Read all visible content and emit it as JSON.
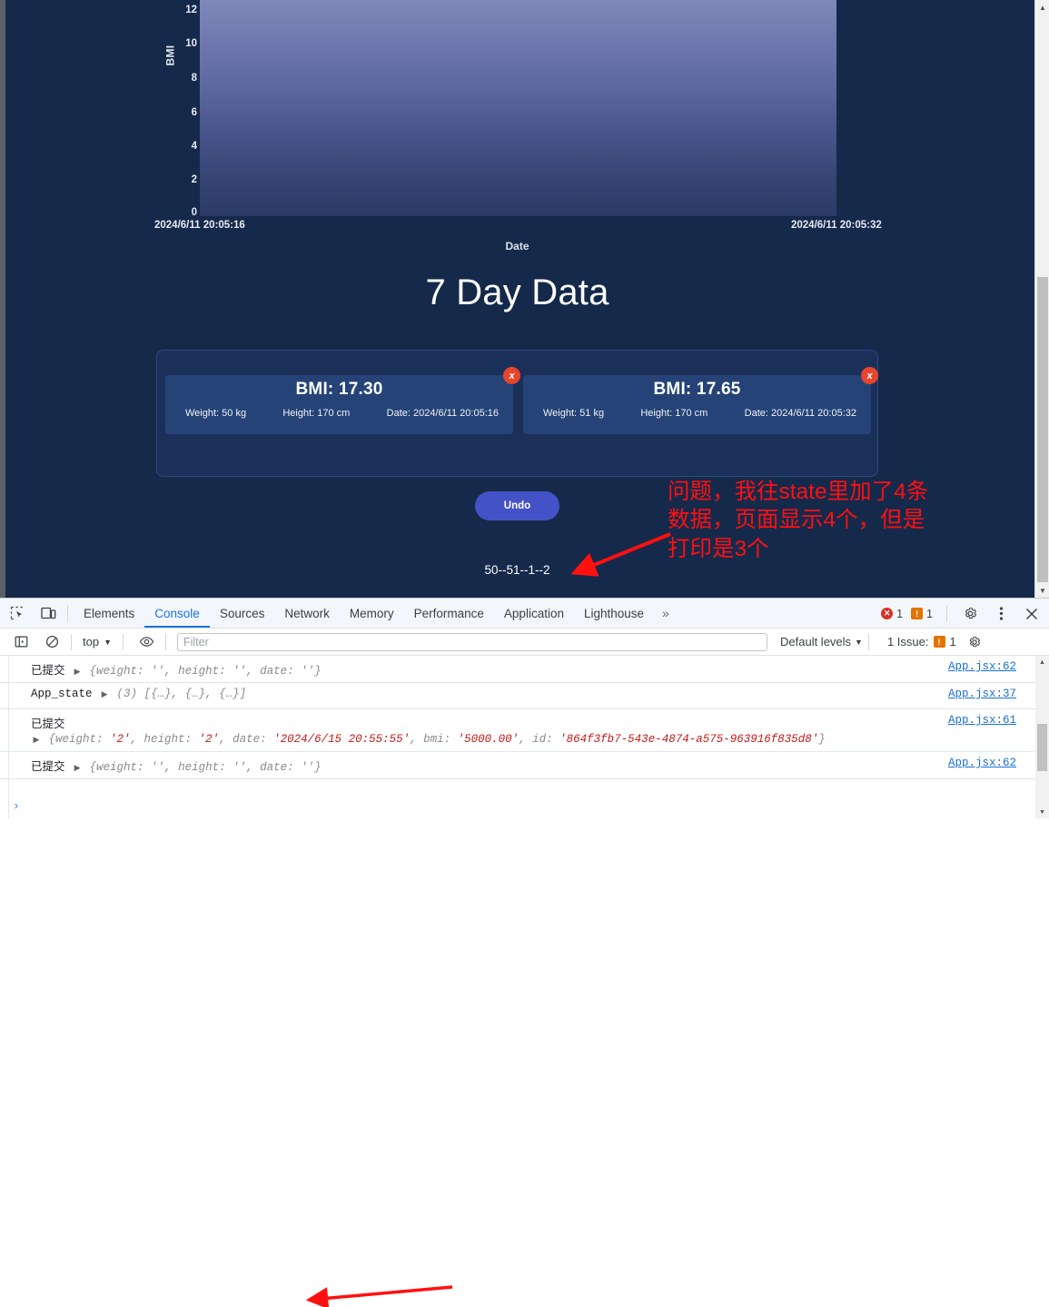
{
  "page": {
    "section_title": "7 Day Data",
    "summary_line": "50--51--1--2",
    "undo_label": "Undo",
    "annotation": "问题，我往state里加了4条数据，页面显示4个，但是打印是3个"
  },
  "chart_data": {
    "type": "area",
    "title": "",
    "xlabel": "Date",
    "ylabel": "BMI",
    "ylim": [
      0,
      12
    ],
    "yticks": [
      "0",
      "2",
      "4",
      "6",
      "8",
      "10",
      "12"
    ],
    "xticks": [
      "2024/6/11 20:05:16",
      "2024/6/11 20:05:32"
    ],
    "x": [
      "2024/6/11 20:05:16",
      "2024/6/11 20:05:32"
    ],
    "series": [
      {
        "name": "BMI",
        "values": [
          17.3,
          17.65
        ]
      }
    ],
    "grid": false,
    "legend": "none",
    "fill_top_color": "#7f88b8",
    "fill_bottom_color": "#2b3a66",
    "note": "Filled area fully saturating plot area; y-axis max 12 while data exceeds range"
  },
  "cards": [
    {
      "bmi": "BMI: 17.30",
      "weight": "Weight: 50 kg",
      "height": "Height: 170 cm",
      "date": "Date: 2024/6/11 20:05:16",
      "close_label": "x"
    },
    {
      "bmi": "BMI: 17.65",
      "weight": "Weight: 51 kg",
      "height": "Height: 170 cm",
      "date": "Date: 2024/6/11 20:05:32",
      "close_label": "x"
    }
  ],
  "devtools": {
    "tabs": [
      {
        "label": "Elements",
        "active": false
      },
      {
        "label": "Console",
        "active": true
      },
      {
        "label": "Sources",
        "active": false
      },
      {
        "label": "Network",
        "active": false
      },
      {
        "label": "Memory",
        "active": false
      },
      {
        "label": "Performance",
        "active": false
      },
      {
        "label": "Application",
        "active": false
      },
      {
        "label": "Lighthouse",
        "active": false
      }
    ],
    "more_label": "»",
    "error_count": "1",
    "warning_count": "1",
    "context_label": "top",
    "filter_placeholder": "Filter",
    "levels_label": "Default levels",
    "issues_label": "1 Issue:",
    "issues_count": "1",
    "prompt_symbol": "›"
  },
  "console_logs": [
    {
      "label": "已提交",
      "preview": "{weight: '', height: '', date: ''}",
      "source": "App.jsx:62",
      "multiline": false
    },
    {
      "label": "App_state",
      "count": "(3)",
      "preview": "[{…}, {…}, {…}]",
      "source": "App.jsx:37",
      "multiline": false
    },
    {
      "label": "已提交",
      "preview": "{weight: '2', height: '2', date: '2024/6/15 20:55:55', bmi: '5000.00', id: '864f3fb7-543e-4874-a575-963916f835d8'}",
      "source": "App.jsx:61",
      "multiline": true,
      "parts": [
        {
          "t": "{weight: ",
          "k": "p"
        },
        {
          "t": "'2'",
          "k": "s"
        },
        {
          "t": ", height: ",
          "k": "p"
        },
        {
          "t": "'2'",
          "k": "s"
        },
        {
          "t": ", date: ",
          "k": "p"
        },
        {
          "t": "'2024/6/15 20:55:55'",
          "k": "s"
        },
        {
          "t": ", bmi: ",
          "k": "p"
        },
        {
          "t": "'5000.00'",
          "k": "s"
        },
        {
          "t": ", id: ",
          "k": "p"
        },
        {
          "t": "'864f3fb7-543e-4874-a575-963916f835d8'",
          "k": "s"
        },
        {
          "t": "}",
          "k": "p"
        }
      ]
    },
    {
      "label": "已提交",
      "preview": "{weight: '', height: '', date: ''}",
      "source": "App.jsx:62",
      "multiline": false
    }
  ],
  "colors": {
    "page_bg": "#15294b",
    "card_panel_bg": "#1b3059",
    "card_bg": "#254377",
    "accent_button": "#4452c8",
    "close_button": "#e8452c",
    "annotation_red": "#ff1010",
    "devtools_active_tab": "#1a73e8"
  }
}
